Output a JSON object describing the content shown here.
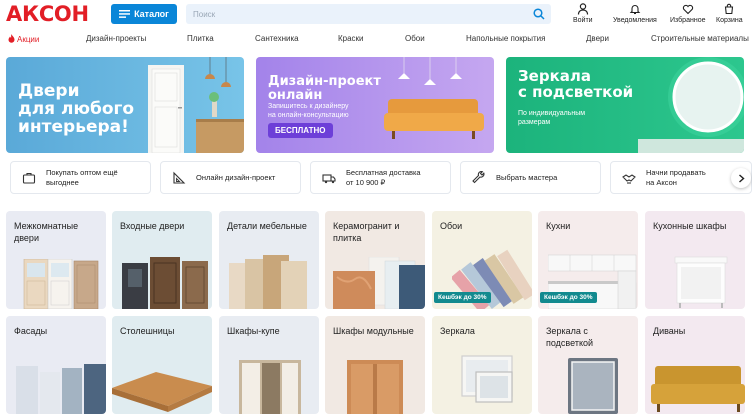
{
  "header": {
    "logo": "АКСОН",
    "catalog_label": "Каталог",
    "search_placeholder": "Поиск",
    "actions": [
      {
        "label": "Войти",
        "icon": "user-icon"
      },
      {
        "label": "Уведомления",
        "icon": "bell-icon"
      },
      {
        "label": "Избранное",
        "icon": "heart-icon"
      },
      {
        "label": "Корзина",
        "icon": "cart-icon"
      }
    ]
  },
  "nav": {
    "items": [
      "Акции",
      "Дизайн-проекты",
      "Плитка",
      "Сантехника",
      "Краски",
      "Обои",
      "Напольные покрытия",
      "Двери",
      "Строительные материалы"
    ]
  },
  "banners": [
    {
      "title_lines": [
        "Двери",
        "для любого",
        "интерьера!"
      ]
    },
    {
      "title_lines": [
        "Дизайн-проект",
        "онлайн"
      ],
      "sub_lines": [
        "Запишитесь к дизайнеру",
        "на онлайн-консультацию"
      ],
      "button": "БЕСПЛАТНО"
    },
    {
      "title_lines": [
        "Зеркала",
        "с подсветкой"
      ],
      "sub_lines": [
        "По индивидуальным",
        "размерам"
      ]
    }
  ],
  "features": [
    {
      "lines": [
        "Покупать оптом ещё",
        "выгоднее"
      ],
      "icon": "briefcase-icon"
    },
    {
      "lines": [
        "Онлайн дизайн-проект"
      ],
      "icon": "ruler-icon"
    },
    {
      "lines": [
        "Бесплатная доставка",
        "от 10 900 ₽"
      ],
      "icon": "truck-icon"
    },
    {
      "lines": [
        "Выбрать мастера"
      ],
      "icon": "wrench-icon"
    },
    {
      "lines": [
        "Начни продавать",
        "на Аксон"
      ],
      "icon": "handshake-icon"
    }
  ],
  "categories_row1": [
    {
      "label": "Межкомнатные двери",
      "bg": "#e9ebf3"
    },
    {
      "label": "Входные двери",
      "bg": "#e0ecf0"
    },
    {
      "label": "Детали мебельные",
      "bg": "#e8ecf2"
    },
    {
      "label": "Керамогранит и плитка",
      "bg": "#f1e9e3"
    },
    {
      "label": "Обои",
      "bg": "#f4f1e3",
      "badge": "Кешбэк до 30%"
    },
    {
      "label": "Кухни",
      "bg": "#f5ecec",
      "badge": "Кешбэк до 30%"
    },
    {
      "label": "Кухонные шкафы",
      "bg": "#f3e9f0"
    }
  ],
  "categories_row2": [
    {
      "label": "Фасады",
      "bg": "#e9ebf3"
    },
    {
      "label": "Столешницы",
      "bg": "#e0ecf0"
    },
    {
      "label": "Шкафы-купе",
      "bg": "#e8ecf2"
    },
    {
      "label": "Шкафы модульные",
      "bg": "#f1e9e3"
    },
    {
      "label": "Зеркала",
      "bg": "#f4f1e3"
    },
    {
      "label": "Зеркала с подсветкой",
      "bg": "#f5ecec"
    },
    {
      "label": "Диваны",
      "bg": "#f3e9f0"
    }
  ]
}
